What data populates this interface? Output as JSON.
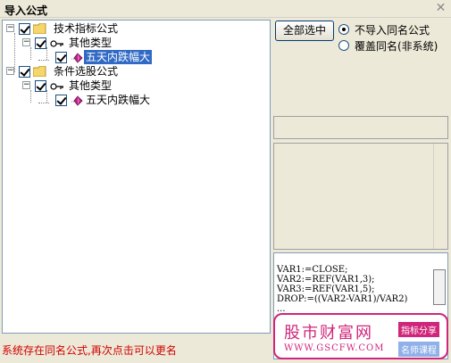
{
  "window": {
    "title": "导入公式",
    "close_glyph": "✕"
  },
  "tree": {
    "nodes": [
      {
        "label": "技术指标公式"
      },
      {
        "label": "其他类型"
      },
      {
        "label": "五天内跌幅大"
      },
      {
        "label": "条件选股公式"
      },
      {
        "label": "其他类型"
      },
      {
        "label": "五天内跌幅大"
      }
    ]
  },
  "controls": {
    "select_all_label": "全部选中",
    "radio_skip_label": "不导入同名公式",
    "radio_overwrite_label": "覆盖同名(非系统)"
  },
  "code": {
    "lines": [
      "VAR1:=CLOSE;",
      "VAR2:=REF(VAR1,3);",
      "VAR3:=REF(VAR1,5);",
      "DROP:=((VAR2-VAR1)/VAR2)",
      "..."
    ]
  },
  "status": "系统存在同名公式,再次点击可以更名",
  "watermark": {
    "brand": "股市财富网",
    "url": "WWW.GSCFW.COM",
    "tag1": "指标分享",
    "tag2": "名师课程"
  },
  "colors": {
    "accent": "#d0257a",
    "selection": "#316ac5",
    "status_text": "#d00000"
  }
}
